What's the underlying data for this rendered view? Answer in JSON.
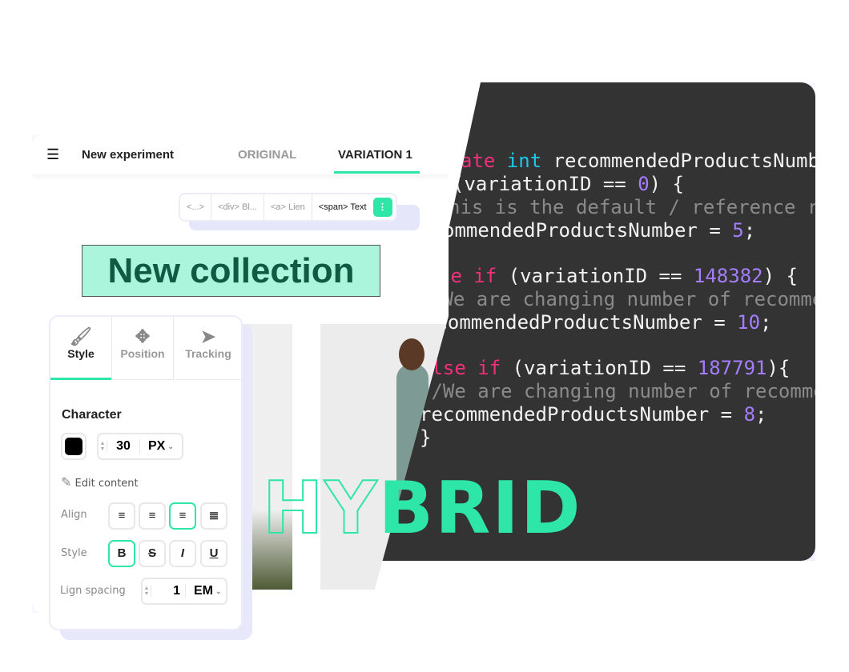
{
  "header": {
    "title": "New experiment",
    "tabs": [
      {
        "label": "ORIGINAL",
        "active": false
      },
      {
        "label": "VARIATION 1",
        "active": true
      }
    ]
  },
  "breadcrumb": [
    "<...>",
    "<div> Bl...",
    "<a> Lien",
    "<span> Text"
  ],
  "headline": "New collection",
  "panel": {
    "tabs": [
      {
        "label": "Style",
        "icon": "brush-icon"
      },
      {
        "label": "Position",
        "icon": "move-icon"
      },
      {
        "label": "Tracking",
        "icon": "cursor-icon"
      }
    ],
    "section": "Character",
    "color": "#000000",
    "font_size": "30",
    "font_unit": "PX",
    "edit_content": "Edit content",
    "align_label": "Align",
    "style_label": "Style",
    "style_buttons": [
      "B",
      "S",
      "I",
      "U"
    ],
    "spacing_label": "Lign spacing",
    "spacing_value": "1",
    "spacing_unit": "EM"
  },
  "code": {
    "lines": [
      [
        [
          "kw",
          "ate "
        ],
        [
          "ty",
          "int "
        ],
        [
          "",
          "recommendedProductsNumb"
        ]
      ],
      [
        [
          "",
          "(variationID == "
        ],
        [
          "num",
          "0"
        ],
        [
          "",
          ") {"
        ]
      ],
      [
        [
          "cm",
          "his is the default / reference r"
        ]
      ],
      [
        [
          "",
          "ommendedProductsNumber = "
        ],
        [
          "num",
          "5"
        ],
        [
          "",
          ";"
        ]
      ],
      [
        [
          "kw",
          "se if "
        ],
        [
          "",
          "(variationID == "
        ],
        [
          "num",
          "148382"
        ],
        [
          "",
          ") {"
        ]
      ],
      [
        [
          "cm",
          "/We are changing number of recomme"
        ]
      ],
      [
        [
          "",
          "ecommendedProductsNumber = "
        ],
        [
          "num",
          "10"
        ],
        [
          "",
          ";"
        ]
      ],
      [
        [
          "",
          "}"
        ]
      ],
      [
        [
          "kw",
          "else if "
        ],
        [
          "",
          "(variationID == "
        ],
        [
          "num",
          "187791"
        ],
        [
          "",
          "){"
        ]
      ],
      [
        [
          "cm",
          "//We are changing number of recomme"
        ]
      ],
      [
        [
          "",
          "recommendedProductsNumber = "
        ],
        [
          "num",
          "8"
        ],
        [
          "",
          ";"
        ]
      ],
      [
        [
          "",
          "}"
        ]
      ]
    ]
  },
  "hybrid": {
    "outlined": "HY",
    "filled": "BRID"
  },
  "colors": {
    "accent": "#2ee6a8",
    "highlight": "#aaf5dc",
    "code_bg": "#333333"
  }
}
